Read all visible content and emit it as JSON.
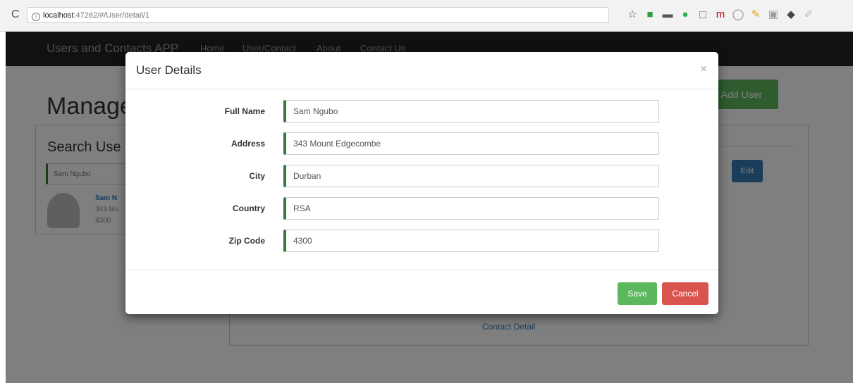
{
  "browser": {
    "reload_glyph": "C",
    "url_host": "localhost",
    "url_rest": ":47262/#/User/detail/1",
    "info_glyph": "i",
    "extensions": [
      {
        "name": "star-icon",
        "glyph": "☆",
        "color": "#555555"
      },
      {
        "name": "extension-icon-1",
        "glyph": "■",
        "color": "#2e9e45"
      },
      {
        "name": "extension-icon-2",
        "glyph": "▬",
        "color": "#555555"
      },
      {
        "name": "check-icon",
        "glyph": "●",
        "color": "#2bb24c"
      },
      {
        "name": "extension-icon-3",
        "glyph": "◻",
        "color": "#888888"
      },
      {
        "name": "m-icon",
        "glyph": "m",
        "color": "#d0021b"
      },
      {
        "name": "extension-icon-4",
        "glyph": "◯",
        "color": "#888888"
      },
      {
        "name": "pen-icon",
        "glyph": "✎",
        "color": "#e8a317"
      },
      {
        "name": "extension-icon-5",
        "glyph": "▣",
        "color": "#999999"
      },
      {
        "name": "extension-icon-6",
        "glyph": "◆",
        "color": "#444444"
      },
      {
        "name": "extension-icon-7",
        "glyph": "✐",
        "color": "#bbbbbb"
      }
    ]
  },
  "navbar": {
    "brand": "Users and Contacts APP",
    "links": [
      "Home",
      "User/Contact",
      "About",
      "Contact Us"
    ]
  },
  "page": {
    "title": "Manage",
    "add_user_label": "Add User",
    "search_title": "Search Use",
    "search_value": "Sam Ngubo",
    "result_name": "Sam N",
    "result_address": "343 Mo",
    "result_zip": "4300",
    "edit_label": "Edit",
    "contact_detail_label": "Contact Detail"
  },
  "modal": {
    "title": "User Details",
    "close_glyph": "×",
    "fields": [
      {
        "label": "Full Name",
        "value": "Sam Ngubo"
      },
      {
        "label": "Address",
        "value": "343 Mount Edgecombe"
      },
      {
        "label": "City",
        "value": "Durban"
      },
      {
        "label": "Country",
        "value": "RSA"
      },
      {
        "label": "Zip Code",
        "value": "4300"
      }
    ],
    "save_label": "Save",
    "cancel_label": "Cancel"
  },
  "colors": {
    "navbar": "#222222",
    "success": "#5cb85c",
    "danger": "#d9534f",
    "primary": "#337ab7",
    "field_accent": "#3c763d"
  }
}
